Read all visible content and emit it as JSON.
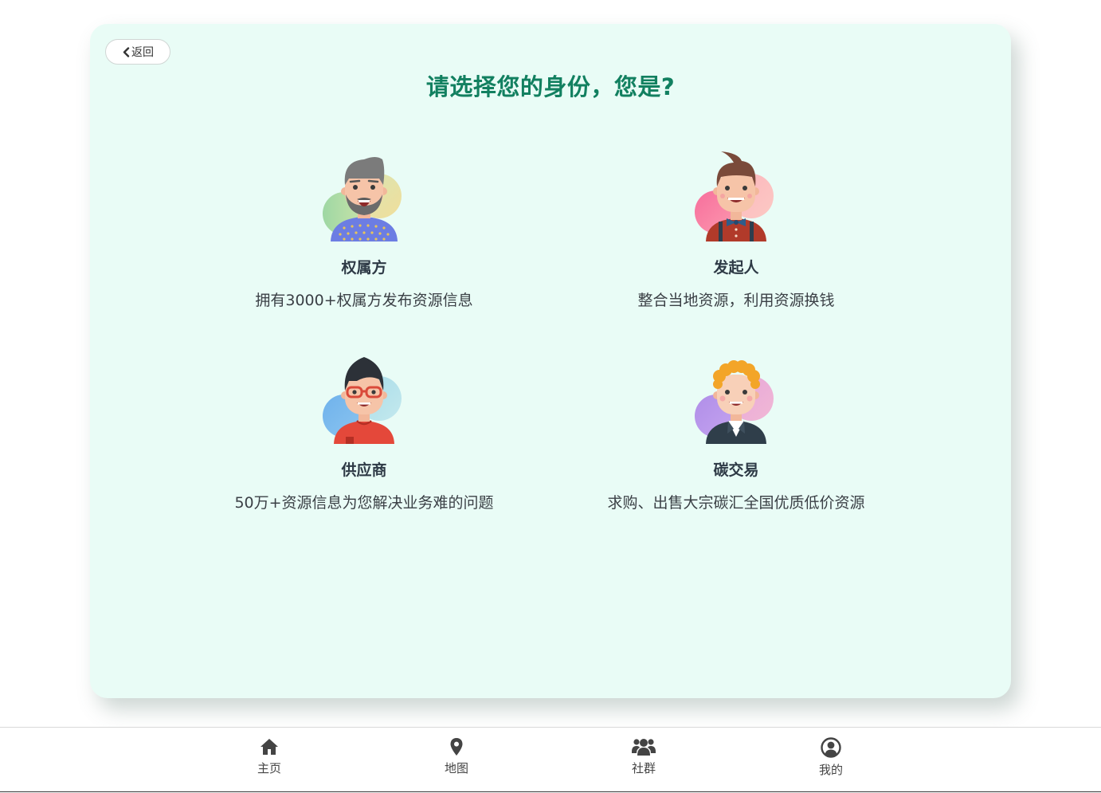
{
  "header": {
    "back_label": "返回",
    "title": "请选择您的身份，您是?"
  },
  "roles": [
    {
      "name": "权属方",
      "desc": "拥有3000+权属方发布资源信息",
      "icon": "bearded-man-avatar-icon"
    },
    {
      "name": "发起人",
      "desc": "整合当地资源，利用资源换钱",
      "icon": "bowtie-man-avatar-icon"
    },
    {
      "name": "供应商",
      "desc": "50万+资源信息为您解决业务难的问题",
      "icon": "glasses-man-avatar-icon"
    },
    {
      "name": "碳交易",
      "desc": "求购、出售大宗碳汇全国优质低价资源",
      "icon": "curly-hair-man-avatar-icon"
    }
  ],
  "nav": [
    {
      "label": "主页",
      "icon": "home-icon"
    },
    {
      "label": "地图",
      "icon": "map-pin-icon"
    },
    {
      "label": "社群",
      "icon": "users-icon"
    },
    {
      "label": "我的",
      "icon": "user-circle-icon"
    }
  ],
  "colors": {
    "accent": "#128060",
    "card_bg": "#e9fcf6",
    "text_dark": "#2e3a46"
  }
}
